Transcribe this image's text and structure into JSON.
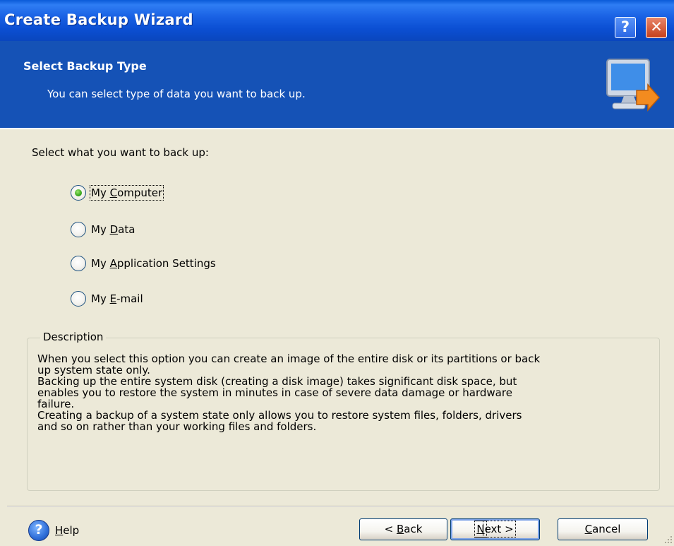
{
  "window": {
    "title": "Create Backup Wizard",
    "help_button": "?",
    "close_button": "✕"
  },
  "header": {
    "title": "Select Backup Type",
    "subtitle": "You can select type of data you want to back up."
  },
  "body": {
    "prompt": "Select what you want to back up:",
    "options": [
      {
        "pre": "My ",
        "accel": "C",
        "post": "omputer",
        "checked": true
      },
      {
        "pre": "My ",
        "accel": "D",
        "post": "ata",
        "checked": false
      },
      {
        "pre": "My ",
        "accel": "A",
        "post": "pplication Settings",
        "checked": false
      },
      {
        "pre": "My ",
        "accel": "E",
        "post": "-mail",
        "checked": false
      }
    ]
  },
  "description": {
    "legend": "Description",
    "lines": [
      "When you select this option you can create an image of the entire disk or its partitions or back",
      "up system state only.",
      "Backing up the entire system disk (creating a disk image) takes significant disk space, but",
      "enables you to restore the system in minutes in case of severe data damage or hardware",
      "failure.",
      "Creating a backup of a system state only allows you to restore system files, folders, drivers",
      "and so on rather than your working files and folders."
    ]
  },
  "footer": {
    "help": {
      "accel": "H",
      "rest": "elp"
    },
    "back": {
      "pre": "< ",
      "accel": "B",
      "post": "ack"
    },
    "next": {
      "pre": "",
      "accel": "N",
      "post": "ext >"
    },
    "cancel": {
      "pre": "",
      "accel": "C",
      "post": "ancel"
    }
  },
  "colors": {
    "header_bg": "#1552b6",
    "dialog_bg": "#ece9d8",
    "radio_checked": "#3aa91e"
  },
  "icons": {
    "header": "computer-backup-icon",
    "help": "help-question-icon"
  }
}
